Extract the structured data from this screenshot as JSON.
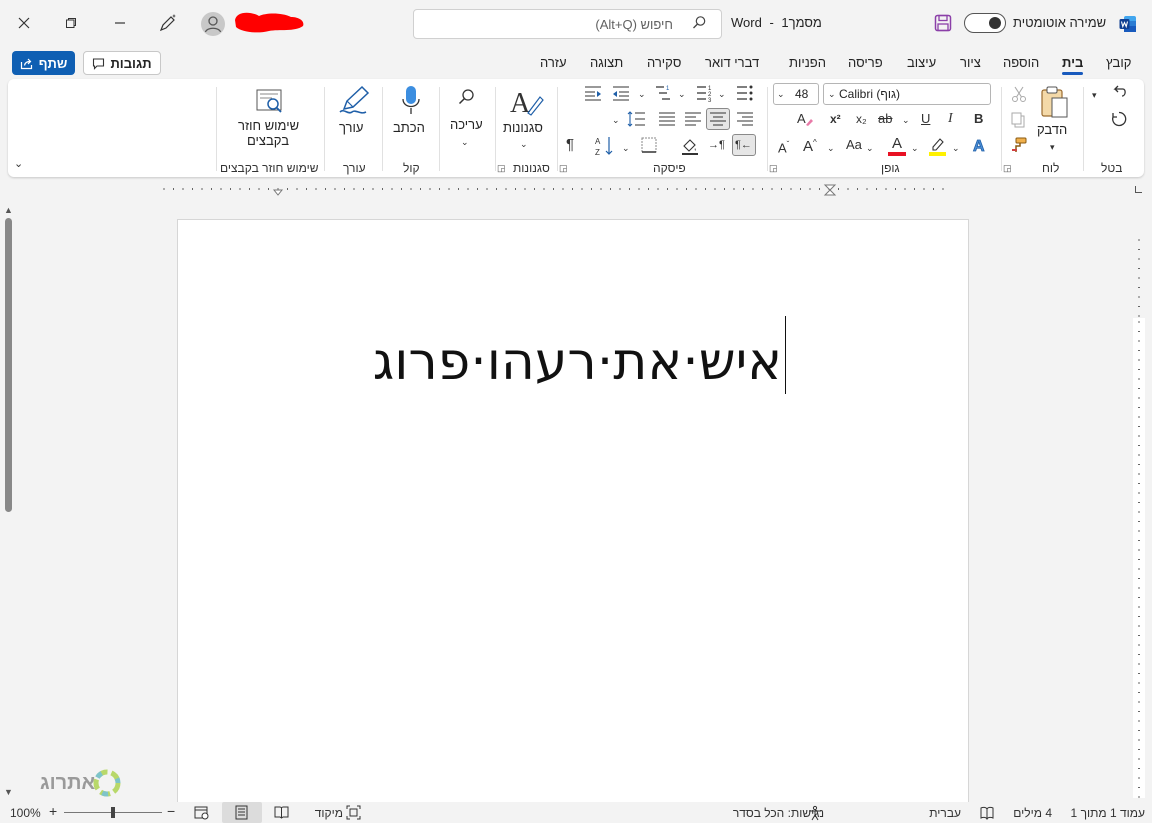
{
  "titlebar": {
    "doc_name": "מסמך1",
    "app_name": "Word",
    "separator": "-",
    "search_placeholder": "חיפוש (Alt+Q)",
    "autosave_label": "שמירה אוטומטית",
    "autosave_on": true,
    "brand_color": "#185abd"
  },
  "tabs": [
    {
      "label": "קובץ",
      "active": false
    },
    {
      "label": "בית",
      "active": true
    },
    {
      "label": "הוספה",
      "active": false
    },
    {
      "label": "ציור",
      "active": false
    },
    {
      "label": "עיצוב",
      "active": false
    },
    {
      "label": "פריסה",
      "active": false
    },
    {
      "label": "הפניות",
      "active": false
    },
    {
      "label": "דברי דואר",
      "active": false
    },
    {
      "label": "סקירה",
      "active": false
    },
    {
      "label": "תצוגה",
      "active": false
    },
    {
      "label": "עזרה",
      "active": false
    }
  ],
  "actions": {
    "share": "שתף",
    "comments": "תגובות"
  },
  "ribbon": {
    "groups": {
      "undo": "בטל",
      "clipboard": "לוח",
      "font": "גופן",
      "paragraph": "פיסקה",
      "styles": "סגנונות",
      "editing_group": "",
      "voice": "קול",
      "editor": "עורך",
      "reuse": "שימוש חוזר בקבצים"
    },
    "paste_label": "הדבק",
    "font_name": "Calibri (גוף)",
    "font_size": "48",
    "styles_label": "סגנונות",
    "editing_label": "עריכה",
    "dictate_label": "הכתב",
    "editor_label": "עורך",
    "reuse_label_line1": "שימוש חוזר",
    "reuse_label_line2": "בקבצים",
    "format_buttons": {
      "bold": "B",
      "italic": "I",
      "underline": "U",
      "strike": "ab",
      "subscript": "x₂",
      "superscript": "x²",
      "change_case": "Aa",
      "font_color": "A",
      "text_effects": "A"
    }
  },
  "document": {
    "text": "איש·את·רעהו·פרוג"
  },
  "statusbar": {
    "page": "עמוד 1 מתוך 1",
    "words": "4 מילים",
    "language": "עברית",
    "accessibility": "נגישות: הכל בסדר",
    "focus": "מיקוד",
    "zoom": "100%",
    "zoom_level": 1.0
  },
  "watermark": "אתרוג",
  "colors": {
    "share_blue": "#0f5fb3",
    "font_color_red": "#e81123",
    "highlight_yellow": "#fff100",
    "save_purple": "#8b3fa8"
  }
}
